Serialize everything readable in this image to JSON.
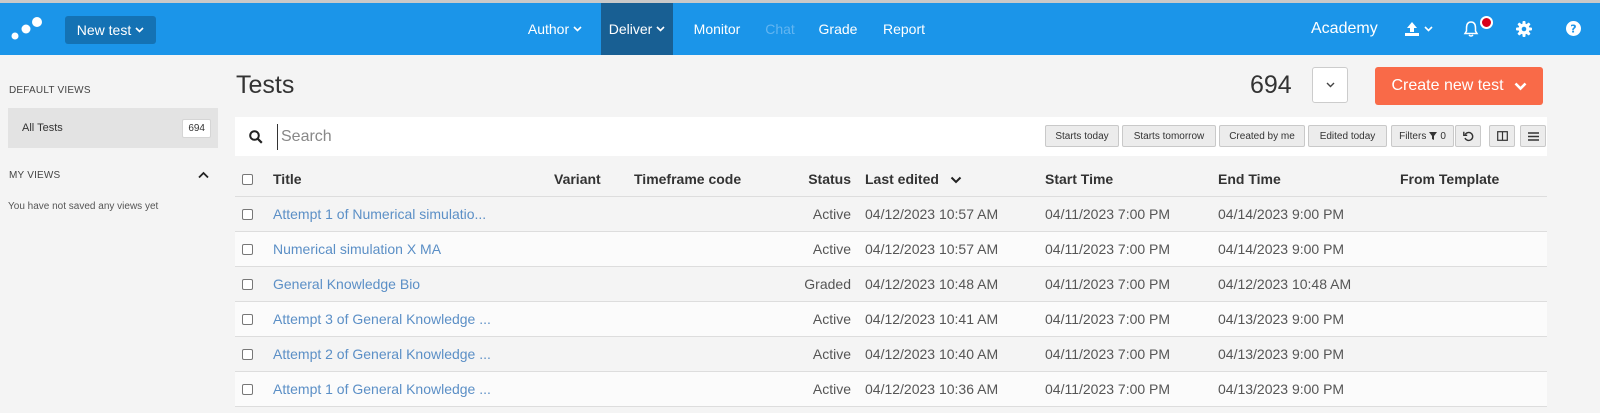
{
  "topbar": {
    "new_test_label": "New test",
    "nav": [
      {
        "label": "Author",
        "has_dropdown": true
      },
      {
        "label": "Deliver",
        "has_dropdown": true,
        "active": true
      },
      {
        "label": "Monitor"
      },
      {
        "label": "Chat",
        "disabled": true
      },
      {
        "label": "Grade"
      },
      {
        "label": "Report"
      }
    ],
    "academy_label": "Academy",
    "icons": [
      "logo-dots-icon",
      "upload-icon",
      "bell-icon",
      "gear-icon",
      "help-icon"
    ]
  },
  "sidebar": {
    "default_views_title": "DEFAULT VIEWS",
    "items": [
      {
        "label": "All Tests",
        "count": "694"
      }
    ],
    "my_views_title": "MY VIEWS",
    "empty_text": "You have not saved any views yet"
  },
  "main": {
    "title": "Tests",
    "total_count": "694",
    "create_label": "Create new test",
    "search": {
      "placeholder": "Search",
      "value": ""
    },
    "quick_filters": [
      "Starts today",
      "Starts tomorrow",
      "Created by me",
      "Edited today"
    ],
    "filters_label": "Filters",
    "filters_count": "0"
  },
  "table": {
    "columns": [
      "Title",
      "Variant",
      "Timeframe code",
      "Status",
      "Last edited",
      "Start Time",
      "End Time",
      "From Template"
    ],
    "sort_column": "Last edited",
    "rows": [
      {
        "title": "Attempt 1 of Numerical simulatio...",
        "variant": "",
        "timeframe": "",
        "status": "Active",
        "last_edited": "04/12/2023 10:57 AM",
        "start": "04/11/2023 7:00 PM",
        "end": "04/14/2023 9:00 PM",
        "template": ""
      },
      {
        "title": "Numerical simulation X MA",
        "variant": "",
        "timeframe": "",
        "status": "Active",
        "last_edited": "04/12/2023 10:57 AM",
        "start": "04/11/2023 7:00 PM",
        "end": "04/14/2023 9:00 PM",
        "template": ""
      },
      {
        "title": "General Knowledge Bio",
        "variant": "",
        "timeframe": "",
        "status": "Graded",
        "last_edited": "04/12/2023 10:48 AM",
        "start": "04/11/2023 7:00 PM",
        "end": "04/12/2023 10:48 AM",
        "template": ""
      },
      {
        "title": "Attempt 3 of General Knowledge ...",
        "variant": "",
        "timeframe": "",
        "status": "Active",
        "last_edited": "04/12/2023 10:41 AM",
        "start": "04/11/2023 7:00 PM",
        "end": "04/13/2023 9:00 PM",
        "template": ""
      },
      {
        "title": "Attempt 2 of General Knowledge ...",
        "variant": "",
        "timeframe": "",
        "status": "Active",
        "last_edited": "04/12/2023 10:40 AM",
        "start": "04/11/2023 7:00 PM",
        "end": "04/13/2023 9:00 PM",
        "template": ""
      },
      {
        "title": "Attempt 1 of General Knowledge ...",
        "variant": "",
        "timeframe": "",
        "status": "Active",
        "last_edited": "04/12/2023 10:36 AM",
        "start": "04/11/2023 7:00 PM",
        "end": "04/13/2023 9:00 PM",
        "template": ""
      }
    ]
  },
  "colors": {
    "topbar": "#1b95e9",
    "nav_active": "#185f93",
    "create_button": "#f96a48",
    "link": "#5b8fc6",
    "notification": "#d9001b"
  }
}
